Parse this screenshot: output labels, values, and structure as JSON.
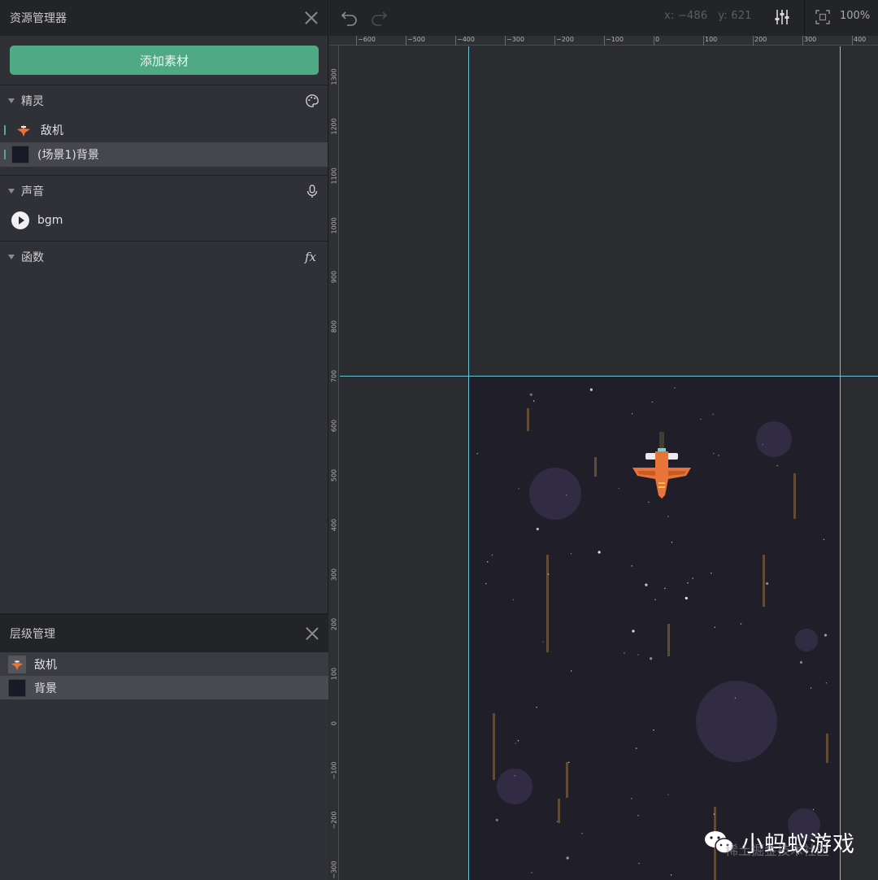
{
  "asset_panel": {
    "title": "资源管理器",
    "add_button": "添加素材",
    "sprites": {
      "header": "精灵",
      "icon": "palette-icon",
      "items": [
        {
          "label": "敌机",
          "thumb": "orange-plane"
        },
        {
          "label": "(场景1)背景",
          "thumb": "dark-background",
          "selected": true
        }
      ]
    },
    "sounds": {
      "header": "声音",
      "icon": "microphone-icon",
      "items": [
        {
          "label": "bgm",
          "thumb": "play-icon"
        }
      ]
    },
    "functions": {
      "header": "函数",
      "icon": "fx-icon",
      "fx_label": "fx"
    }
  },
  "layer_panel": {
    "title": "层级管理",
    "items": [
      {
        "label": "敌机"
      },
      {
        "label": "背景",
        "selected": true
      }
    ]
  },
  "toolbar": {
    "x_label": "x:",
    "x_value": "−486",
    "y_label": "y:",
    "y_value": "621",
    "zoom": "100%"
  },
  "rulers": {
    "horizontal": [
      "−600",
      "−500",
      "−400",
      "−300",
      "−200",
      "−100",
      "0",
      "100",
      "200",
      "300",
      "400"
    ],
    "vertical": [
      "1300",
      "1200",
      "1100",
      "1000",
      "900",
      "800",
      "700",
      "600",
      "500",
      "400",
      "300",
      "200",
      "100",
      "0",
      "−100",
      "−200",
      "−300"
    ]
  },
  "colors": {
    "accent": "#4fa985",
    "guide": "#67c6d6",
    "scene": "#201f29",
    "plane": "#e8743a"
  },
  "watermark": {
    "text": "小蚂蚁游戏",
    "sub": "稀土掘金技术社区"
  }
}
